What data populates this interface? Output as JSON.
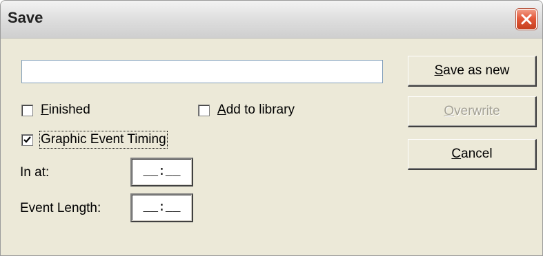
{
  "window": {
    "title": "Save"
  },
  "filename_input": {
    "value": "",
    "placeholder": ""
  },
  "checkboxes": {
    "finished": {
      "label_first": "F",
      "label_rest": "inished",
      "checked": false
    },
    "add_to_library": {
      "label_first": "A",
      "label_rest": "dd to library",
      "checked": false
    },
    "graphic_event_timing": {
      "label": "Graphic Event Timing",
      "checked": true
    }
  },
  "timing": {
    "in_at_label": "In at:",
    "in_at_value": "__:__",
    "event_length_label": "Event Length:",
    "event_length_value": "__:__"
  },
  "buttons": {
    "save_as_new": {
      "first": "S",
      "rest": "ave as new"
    },
    "overwrite": {
      "first": "O",
      "rest": "verwrite",
      "enabled": false
    },
    "cancel": {
      "first": "C",
      "rest": "ancel"
    }
  },
  "icons": {
    "close": "close-icon",
    "check": "checkmark-icon"
  }
}
